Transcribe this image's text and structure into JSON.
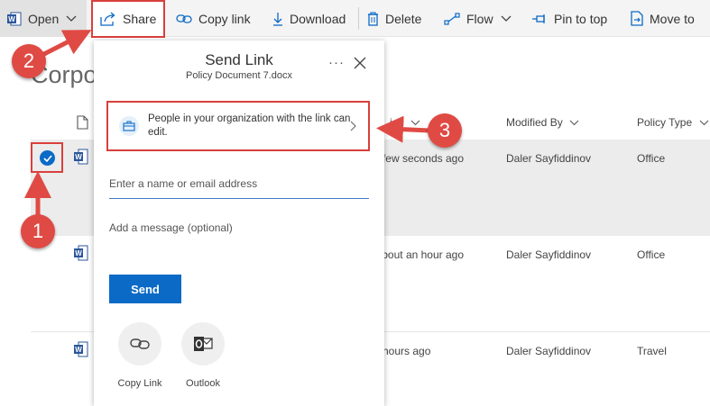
{
  "toolbar": {
    "open_label": "Open",
    "share_label": "Share",
    "copy_link_label": "Copy link",
    "download_label": "Download",
    "delete_label": "Delete",
    "flow_label": "Flow",
    "pin_label": "Pin to top",
    "move_label": "Move to"
  },
  "library": {
    "title": "Corporate Policies",
    "columns": {
      "modified": "ied",
      "modified_by": "Modified By",
      "policy_type": "Policy Type"
    },
    "rows": [
      {
        "modified": "few seconds ago",
        "modified_by": "Daler Sayfiddinov",
        "policy_type": "Office",
        "selected": true
      },
      {
        "modified": "bout an hour ago",
        "modified_by": "Daler Sayfiddinov",
        "policy_type": "Office",
        "selected": false
      },
      {
        "modified": "hours ago",
        "modified_by": "Daler Sayfiddinov",
        "policy_type": "Travel",
        "selected": false
      }
    ]
  },
  "dialog": {
    "title": "Send Link",
    "subtitle": "Policy Document 7.docx",
    "more_label": "···",
    "link_setting": "People in your organization with the link can edit.",
    "recipient_placeholder": "Enter a name or email address",
    "message_placeholder": "Add a message (optional)",
    "send_label": "Send",
    "share_options": [
      {
        "label": "Copy Link",
        "icon": "link-icon"
      },
      {
        "label": "Outlook",
        "icon": "outlook-icon"
      }
    ]
  },
  "annotations": {
    "step1": "1",
    "step2": "2",
    "step3": "3",
    "color": "#d93f3c"
  },
  "colors": {
    "accent": "#0a6ac6",
    "word": "#2b579a"
  }
}
